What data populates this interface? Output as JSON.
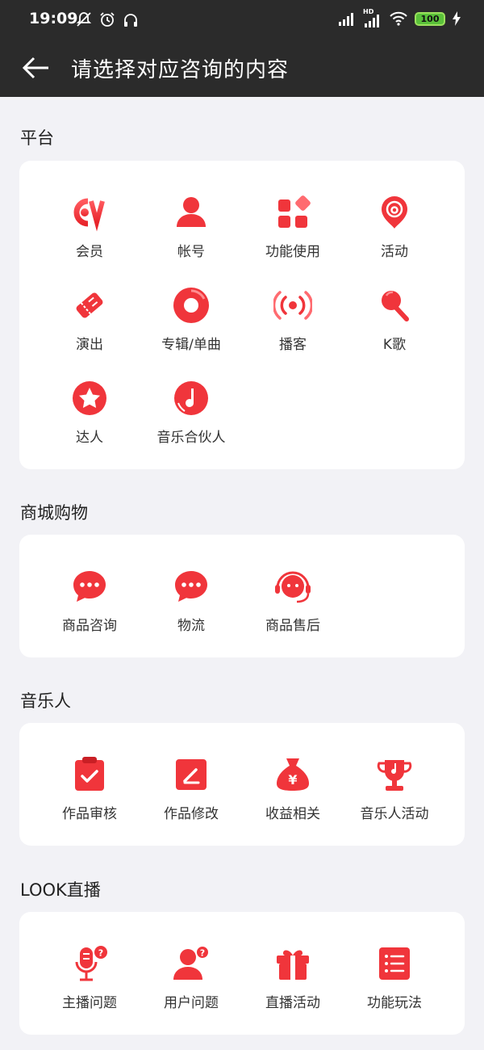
{
  "status": {
    "time": "19:09",
    "battery": "100",
    "network": "HD"
  },
  "header": {
    "title": "请选择对应咨询的内容"
  },
  "sections": [
    {
      "title": "平台",
      "items": [
        {
          "label": "会员",
          "icon": "vip-icon"
        },
        {
          "label": "帐号",
          "icon": "account-icon"
        },
        {
          "label": "功能使用",
          "icon": "features-icon"
        },
        {
          "label": "活动",
          "icon": "activity-icon"
        },
        {
          "label": "演出",
          "icon": "ticket-icon"
        },
        {
          "label": "专辑/单曲",
          "icon": "album-icon"
        },
        {
          "label": "播客",
          "icon": "podcast-icon"
        },
        {
          "label": "K歌",
          "icon": "karaoke-icon"
        },
        {
          "label": "达人",
          "icon": "star-icon"
        },
        {
          "label": "音乐合伙人",
          "icon": "music-partner-icon"
        }
      ]
    },
    {
      "title": "商城购物",
      "items": [
        {
          "label": "商品咨询",
          "icon": "chat-icon"
        },
        {
          "label": "物流",
          "icon": "chat-icon"
        },
        {
          "label": "商品售后",
          "icon": "support-headset-icon"
        }
      ]
    },
    {
      "title": "音乐人",
      "items": [
        {
          "label": "作品审核",
          "icon": "clipboard-check-icon"
        },
        {
          "label": "作品修改",
          "icon": "edit-icon"
        },
        {
          "label": "收益相关",
          "icon": "money-bag-icon"
        },
        {
          "label": "音乐人活动",
          "icon": "trophy-icon"
        }
      ]
    },
    {
      "title": "LOOK直播",
      "items": [
        {
          "label": "主播问题",
          "icon": "mic-question-icon"
        },
        {
          "label": "用户问题",
          "icon": "user-question-icon"
        },
        {
          "label": "直播活动",
          "icon": "gift-icon"
        },
        {
          "label": "功能玩法",
          "icon": "list-icon"
        }
      ]
    }
  ],
  "colors": {
    "accent": "#f0353b",
    "header_bg": "#2b2b2b",
    "page_bg": "#f2f2f6"
  }
}
